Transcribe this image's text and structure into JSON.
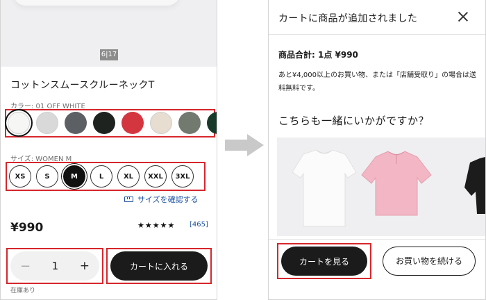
{
  "left": {
    "image_counter": "6|17",
    "product_name": "コットンスムースクルーネックT",
    "color_label": "カラー: 01 OFF WHITE",
    "swatches": [
      {
        "name": "off-white",
        "color": "#f6f6f4",
        "selected": true
      },
      {
        "name": "light-gray",
        "color": "#d9d9d9",
        "selected": false
      },
      {
        "name": "gray",
        "color": "#5c5f63",
        "selected": false
      },
      {
        "name": "black",
        "color": "#1f2320",
        "selected": false
      },
      {
        "name": "red",
        "color": "#d4363f",
        "selected": false
      },
      {
        "name": "beige",
        "color": "#e7ddd0",
        "selected": false
      },
      {
        "name": "olive",
        "color": "#727a70",
        "selected": false
      },
      {
        "name": "dark-green",
        "color": "#183a2a",
        "selected": false
      }
    ],
    "size_label": "サイズ: WOMEN M",
    "sizes": [
      {
        "label": "XS",
        "selected": false
      },
      {
        "label": "S",
        "selected": false
      },
      {
        "label": "M",
        "selected": true
      },
      {
        "label": "L",
        "selected": false
      },
      {
        "label": "XL",
        "selected": false
      },
      {
        "label": "XXL",
        "selected": false
      },
      {
        "label": "3XL",
        "selected": false
      }
    ],
    "size_guide_link": "サイズを確認する",
    "price": "¥990",
    "rating_stars": "★★★★★",
    "rating_value": 4.5,
    "review_count": "[465]",
    "quantity": {
      "minus": "−",
      "value": "1",
      "plus": "+"
    },
    "add_to_cart": "カートに入れる",
    "stock_status": "在庫あり"
  },
  "right": {
    "title": "カートに商品が追加されました",
    "total": "商品合計: 1点 ¥990",
    "shipping_note": "あと¥4,000以上のお買い物、または「店舗受取り」の場合は送料無料です。",
    "recommend_title": "こちらも一緒にいかがですか？",
    "recommended_items": [
      {
        "name": "white-tshirt",
        "color": "#fbfbfb"
      },
      {
        "name": "pink-tshirt",
        "color": "#f2b6c4"
      },
      {
        "name": "black-tshirt",
        "color": "#1c1c1c"
      }
    ],
    "view_cart": "カートを見る",
    "continue_shopping": "お買い物を続ける"
  },
  "colors": {
    "highlight_box": "#d6262c",
    "link": "#1a4fa0",
    "primary_button": "#1b1b1b"
  }
}
